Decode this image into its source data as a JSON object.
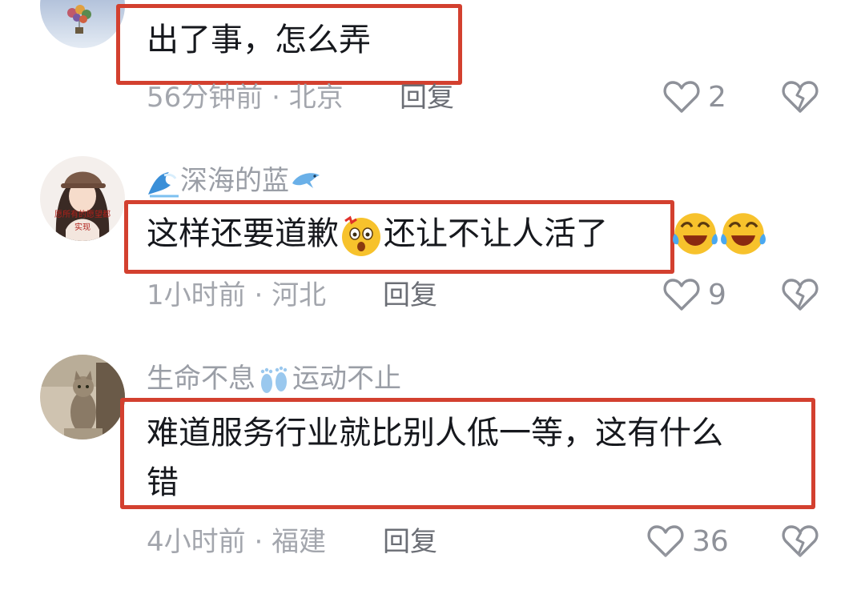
{
  "colors": {
    "highlight": "#d3402f",
    "meta": "#a3a6ad",
    "username": "#9a9ea6",
    "text": "#16181d"
  },
  "comments": [
    {
      "avatar": "balloon-avatar",
      "username": "",
      "text": "出了事，怎么弄",
      "time": "56分钟前",
      "location": "北京",
      "reply_label": "回复",
      "likes": "2"
    },
    {
      "avatar": "girl-avatar",
      "avatar_text_1": "愿所有的愿望都",
      "avatar_text_2": "实现",
      "username": "深海的蓝",
      "username_prefix_icon": "wave-icon",
      "username_suffix_icon": "dolphin-icon",
      "text_before": "这样还要道歉",
      "text_mid_icon": "shocked-face-icon",
      "text_after": "还让不让人活了",
      "trailing_icons": [
        "laughing-crying-icon",
        "laughing-crying-icon"
      ],
      "time": "1小时前",
      "location": "河北",
      "reply_label": "回复",
      "likes": "9"
    },
    {
      "avatar": "cat-avatar",
      "username_part1": "生命不息",
      "username_icon": "footprints-icon",
      "username_part2": "运动不止",
      "text_line1": "难道服务行业就比别人低一等，这有什么",
      "text_line2": "错",
      "time": "4小时前",
      "location": "福建",
      "reply_label": "回复",
      "likes": "36"
    }
  ]
}
